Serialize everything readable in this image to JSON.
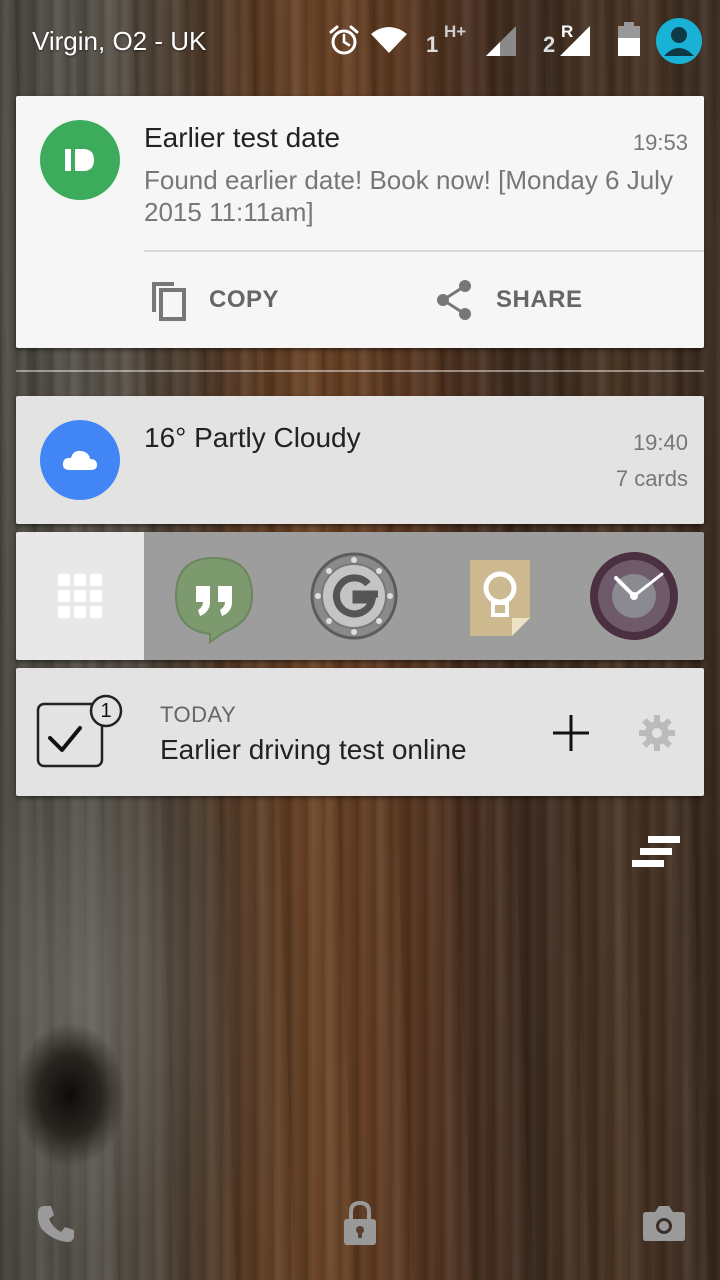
{
  "status_bar": {
    "carrier": "Virgin, O2 - UK",
    "sim1_label": "1",
    "sim1_network": "H+",
    "sim2_label": "2",
    "sim2_network": "R",
    "icons": [
      "alarm-icon",
      "wifi-icon",
      "signal-icon",
      "signal-icon",
      "battery-icon",
      "user-icon"
    ]
  },
  "notification_pushbullet": {
    "title": "Earlier test date",
    "time": "19:53",
    "text": "Found earlier date! Book now! [Monday 6 July 2015 11:11am]",
    "icon": "pushbullet-icon",
    "icon_color": "#3dab5c",
    "actions": [
      {
        "label": "COPY",
        "icon": "copy-icon"
      },
      {
        "label": "SHARE",
        "icon": "share-icon"
      }
    ]
  },
  "notification_weather": {
    "title": "16° Partly Cloudy",
    "time": "19:40",
    "subtitle": "7 cards",
    "icon": "cloud-icon",
    "icon_color": "#4285f4"
  },
  "app_shortcuts": {
    "launcher_icon": "app-grid-icon",
    "apps": [
      "hangouts-icon",
      "chrome-icon",
      "keep-icon",
      "clock-icon"
    ]
  },
  "todo_widget": {
    "section_label": "TODAY",
    "task": "Earlier driving test online",
    "badge_count": "1",
    "icons": [
      "checkbox-icon",
      "add-icon",
      "gear-icon"
    ]
  },
  "lockscreen": {
    "icons": [
      "dismiss-all-icon",
      "phone-icon",
      "lock-icon",
      "camera-icon"
    ]
  }
}
